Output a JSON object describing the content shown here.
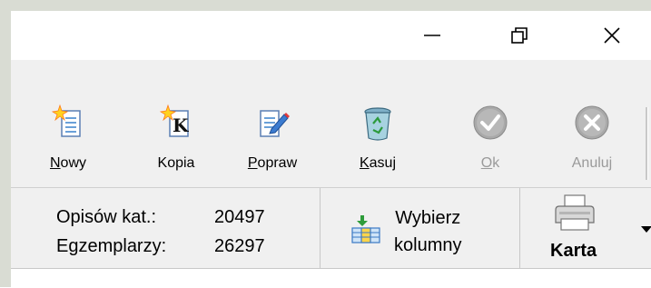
{
  "window": {
    "controls": [
      "minimize",
      "maximize",
      "close"
    ]
  },
  "toolbar": {
    "items": [
      {
        "label": "Nowy",
        "mnemonic": "N",
        "rest": "owy",
        "icon": "new-document-icon",
        "enabled": true
      },
      {
        "label": "Kopia",
        "icon": "copy-document-icon",
        "enabled": true
      },
      {
        "label": "Popraw",
        "mnemonic": "P",
        "rest": "opraw",
        "icon": "edit-document-icon",
        "enabled": true
      },
      {
        "label": "Kasuj",
        "mnemonic": "K",
        "rest": "asuj",
        "icon": "recycle-bin-icon",
        "enabled": true
      },
      {
        "label": "Ok",
        "mnemonic": "O",
        "rest": "k",
        "icon": "check-icon",
        "enabled": false
      },
      {
        "label": "Anuluj",
        "icon": "cancel-icon",
        "enabled": false
      }
    ]
  },
  "stats": {
    "records_label": "Opisów kat.:",
    "records_value": "20497",
    "copies_label": "Egzemplarzy:",
    "copies_value": "26297"
  },
  "columns_button": {
    "line1": "Wybierz",
    "line2": "kolumny"
  },
  "print_button": {
    "label": "Karta"
  },
  "colors": {
    "frame": "#d9dcd3",
    "panel": "#f0f0f0",
    "disabled_text": "#9a9a9a"
  }
}
